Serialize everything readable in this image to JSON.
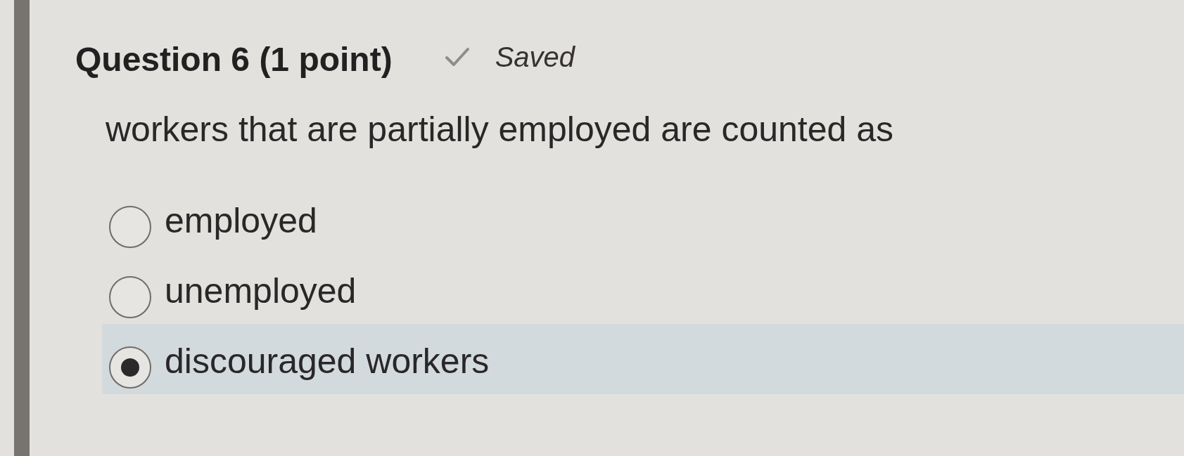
{
  "question": {
    "title": "Question 6 (1 point)",
    "status": "Saved",
    "prompt": "workers that are partially employed are counted as",
    "options": [
      {
        "label": "employed",
        "selected": false
      },
      {
        "label": "unemployed",
        "selected": false
      },
      {
        "label": "discouraged workers",
        "selected": true
      }
    ]
  }
}
